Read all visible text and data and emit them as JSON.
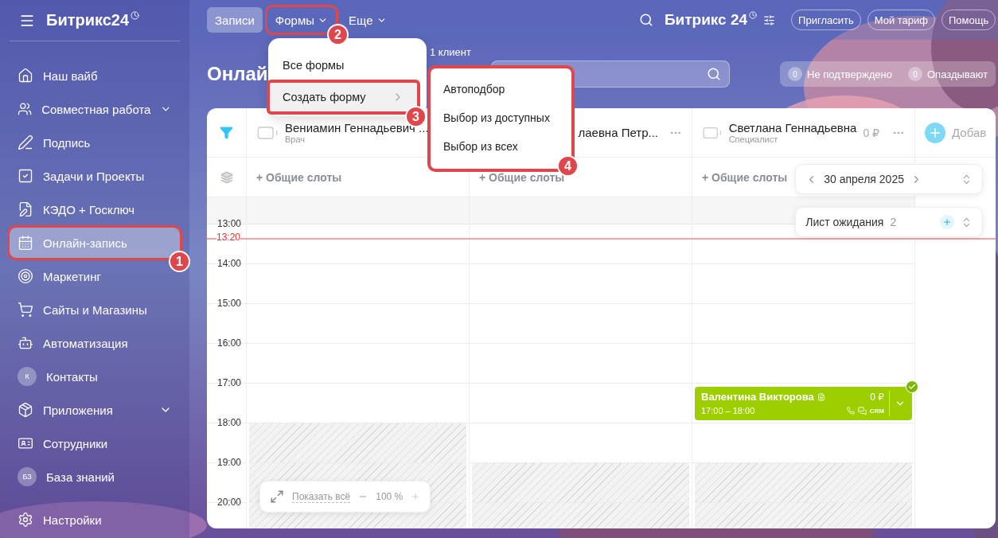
{
  "sidebar": {
    "logo": "Битрикс24",
    "items": [
      {
        "kind": "icon",
        "label": "Наш вайб",
        "selected": false,
        "has_submenu": false
      },
      {
        "kind": "icon",
        "label": "Совместная работа",
        "selected": false,
        "has_submenu": true
      },
      {
        "kind": "icon",
        "label": "Подпись",
        "selected": false,
        "has_submenu": false
      },
      {
        "kind": "icon",
        "label": "Задачи и Проекты",
        "selected": false,
        "has_submenu": false
      },
      {
        "kind": "icon",
        "label": "КЭДО + Госключ",
        "selected": false,
        "has_submenu": false
      },
      {
        "kind": "icon",
        "label": "Онлайн-запись",
        "selected": true,
        "has_submenu": false,
        "callout": "1"
      },
      {
        "kind": "icon",
        "label": "Маркетинг",
        "selected": false,
        "has_submenu": false
      },
      {
        "kind": "icon",
        "label": "Сайты и Магазины",
        "selected": false,
        "has_submenu": false
      },
      {
        "kind": "icon",
        "label": "Автоматизация",
        "selected": false,
        "has_submenu": false
      },
      {
        "kind": "avatar",
        "avatar": "К",
        "label": "Контакты",
        "selected": false,
        "has_submenu": false
      },
      {
        "kind": "icon",
        "label": "Приложения",
        "selected": false,
        "has_submenu": true
      },
      {
        "kind": "icon",
        "label": "Сотрудники",
        "selected": false,
        "has_submenu": false
      },
      {
        "kind": "avatar",
        "avatar": "БЗ",
        "label": "База знаний",
        "selected": false,
        "has_submenu": false
      }
    ],
    "settings": "Настройки"
  },
  "topbar": {
    "tabs": [
      {
        "label": "Записи",
        "selected": true,
        "has_dropdown": false
      },
      {
        "label": "Формы",
        "selected": false,
        "has_dropdown": true,
        "callout": "2"
      },
      {
        "label": "Еще",
        "selected": false,
        "has_dropdown": true
      }
    ],
    "brand": "Битрикс 24",
    "buttons": [
      "Пригласить",
      "Мой тариф",
      "Помощь"
    ]
  },
  "forms_menu": {
    "items": [
      {
        "label": "Все формы",
        "selected": false,
        "has_submenu": false
      },
      {
        "label": "Создать форму",
        "selected": true,
        "has_submenu": true,
        "callout": "3"
      }
    ],
    "submenu": {
      "items": [
        "Автоподбор",
        "Выбор из доступных",
        "Выбор из всех"
      ],
      "callout": "4"
    }
  },
  "header": {
    "title": "Онлай",
    "clients": "1 клиент",
    "counters": [
      {
        "count": "0",
        "label": "Не подтверждено"
      },
      {
        "count": "0",
        "label": "Опаздывают"
      }
    ]
  },
  "calendar": {
    "resources": [
      {
        "name": "Вениамин Геннадьевич ...",
        "role": "Врач",
        "slots": "+ Общие слоты",
        "hours": [
          {
            "blocked": false
          },
          {
            "blocked": false
          },
          {
            "blocked": false
          },
          {
            "blocked": false
          },
          {
            "blocked": false
          },
          {
            "blocked": true
          },
          {
            "blocked": true
          },
          {
            "blocked": true
          }
        ]
      },
      {
        "name": "лаевна Петр...",
        "slots": "+ Общие слоты",
        "hours": [
          {
            "blocked": false
          },
          {
            "blocked": false
          },
          {
            "blocked": false
          },
          {
            "blocked": false
          },
          {
            "blocked": false
          },
          {
            "blocked": false
          },
          {
            "blocked": true
          },
          {
            "blocked": true
          }
        ]
      },
      {
        "name": "Светлана Геннадьевна",
        "role": "Специалист",
        "price": "0 ₽",
        "slots": "+ Общие слоты",
        "hours": [
          {
            "blocked": false
          },
          {
            "blocked": false
          },
          {
            "blocked": false
          },
          {
            "blocked": false
          },
          {
            "blocked": false
          },
          {
            "blocked": false
          },
          {
            "blocked": true
          },
          {
            "blocked": true
          }
        ],
        "events": [
          {
            "name": "Валентина Викторова",
            "time": "17:00 – 18:00",
            "price": "0 ₽",
            "crm": "CRM",
            "confirmed": true
          }
        ]
      }
    ],
    "add_label": "Добав",
    "times": [
      "13:00",
      "14:00",
      "15:00",
      "16:00",
      "17:00",
      "18:00",
      "19:00",
      "20:00"
    ],
    "now": "13:20",
    "date": "30 апреля 2025",
    "waitlist": {
      "label": "Лист ожидания",
      "count": "2"
    },
    "zoom": {
      "show_all": "Показать всё",
      "value": "100 %"
    }
  }
}
